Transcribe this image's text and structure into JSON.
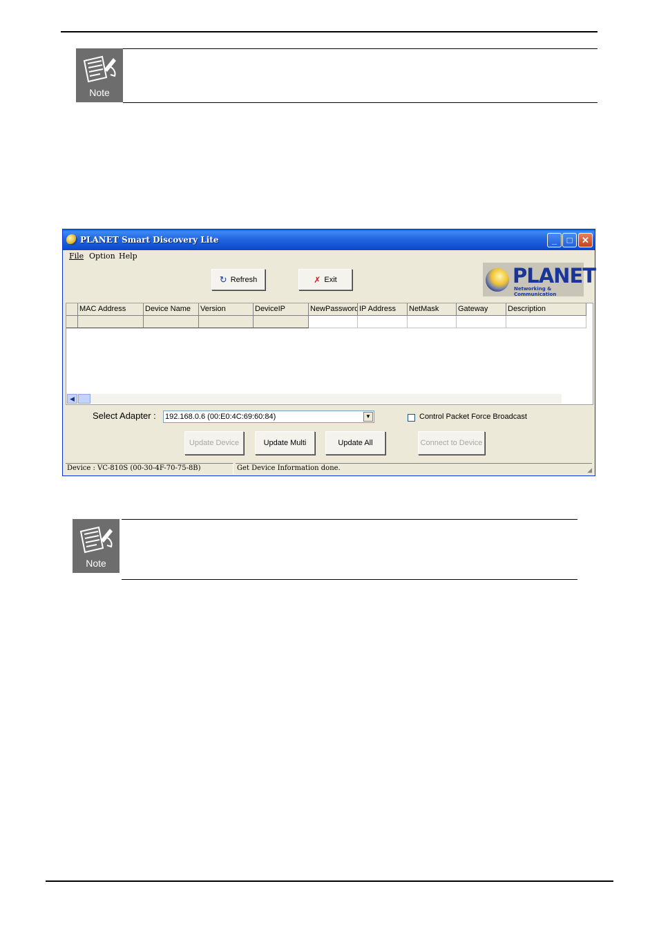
{
  "notes": [
    {
      "label": "Note"
    },
    {
      "label": "Note"
    }
  ],
  "window": {
    "title": "PLANET Smart Discovery Lite",
    "minimize": "_",
    "maximize": "□",
    "close": "✕"
  },
  "menu": [
    "File",
    "Option",
    "Help"
  ],
  "toolbar": {
    "refresh_label": "Refresh",
    "exit_label": "Exit"
  },
  "logo": {
    "text": "PLANET",
    "subtext": "Networking & Communication"
  },
  "table": {
    "columns": [
      "MAC Address",
      "Device Name",
      "Version",
      "DeviceIP",
      "NewPassword",
      "IP Address",
      "NetMask",
      "Gateway",
      "Description"
    ]
  },
  "adapter": {
    "label": "Select Adapter :",
    "value": "192.168.0.6 (00:E0:4C:69:60:84)"
  },
  "broadcast_checkbox": {
    "label": "Control Packet Force Broadcast",
    "checked": false
  },
  "actions": {
    "update_device": "Update Device",
    "update_multi": "Update Multi",
    "update_all": "Update All",
    "connect_to_device": "Connect to Device"
  },
  "statusbar": {
    "device": "Device : VC-810S (00-30-4F-70-75-8B)",
    "message": "Get Device Information done."
  },
  "colors": {
    "titlebar": "#2466e0",
    "window_bg": "#ece9d8",
    "note_bg": "#6d6d6d",
    "logo_text": "#1a3598"
  }
}
